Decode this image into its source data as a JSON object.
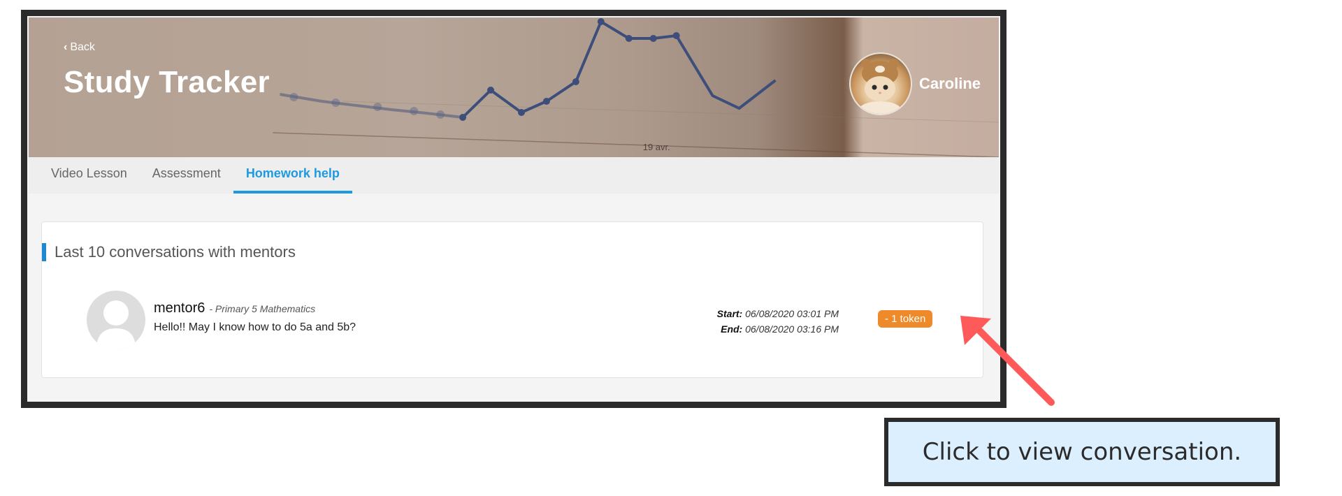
{
  "header": {
    "back_label": "Back",
    "title": "Study Tracker",
    "user_name": "Caroline",
    "background_chart_label": "19 avr."
  },
  "tabs": [
    {
      "label": "Video Lesson",
      "active": false
    },
    {
      "label": "Assessment",
      "active": false
    },
    {
      "label": "Homework help",
      "active": true
    }
  ],
  "section": {
    "title": "Last 10 conversations with mentors",
    "conversations": [
      {
        "mentor": "mentor6",
        "subject": "- Primary 5 Mathematics",
        "message": "Hello!! May I know how to do 5a and 5b?",
        "start_label": "Start:",
        "start": "06/08/2020 03:01 PM",
        "end_label": "End:",
        "end": "06/08/2020 03:16 PM",
        "token": "- 1 token"
      }
    ]
  },
  "annotation": {
    "callout": "Click to view conversation.",
    "arrow_color": "#ff5a5a"
  },
  "colors": {
    "accent": "#1e9ae0",
    "token": "#ef8a2a",
    "frame": "#2b2b2b",
    "callout_bg": "#dcefff"
  }
}
